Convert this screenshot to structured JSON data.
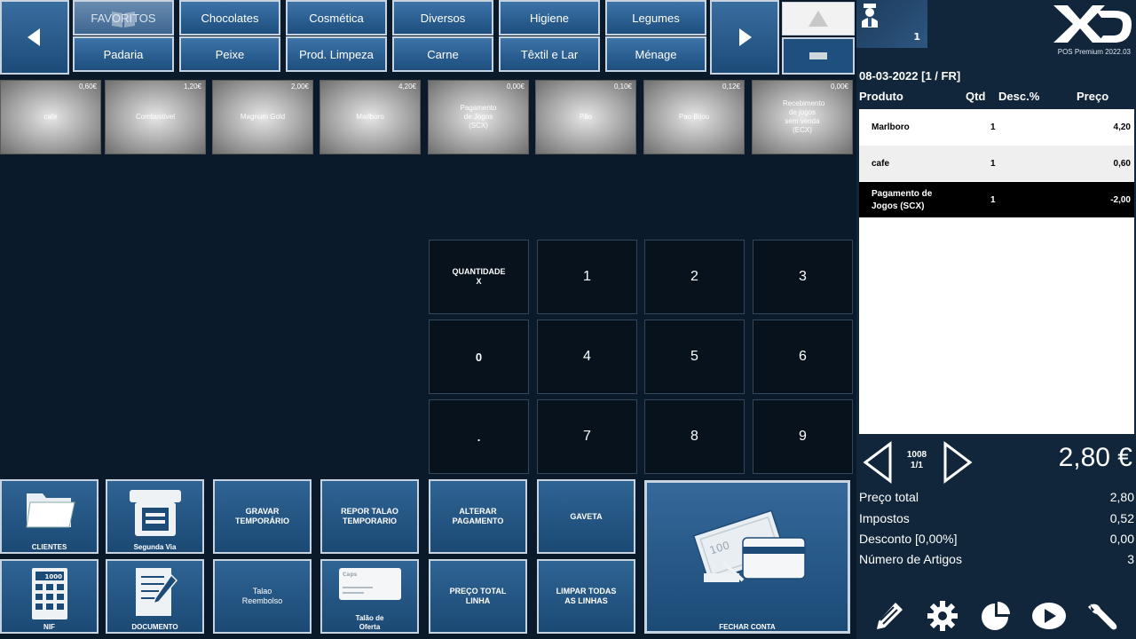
{
  "categories": {
    "row1": [
      "FAVORITOS",
      "Chocolates",
      "Cosmética",
      "Diversos",
      "Higiene",
      "Legumes"
    ],
    "row2": [
      "Padaria",
      "Peixe",
      "Prod. Limpeza",
      "Carne",
      "Têxtil e Lar",
      "Ménage"
    ]
  },
  "products": [
    {
      "name": "cafe",
      "price": "0,60€"
    },
    {
      "name": "Combustivel",
      "price": "1,20€"
    },
    {
      "name": "Magnum Gold",
      "price": "2,00€"
    },
    {
      "name": "Marlboro",
      "price": "4,20€"
    },
    {
      "name": "Pagamento de Jogos (SCX)",
      "price": "0,00€"
    },
    {
      "name": "Pão",
      "price": "0,10€"
    },
    {
      "name": "Pao Bijou",
      "price": "0,12€"
    },
    {
      "name": "Recebimento de jogos sem venda (ECX)",
      "price": "0,00€"
    }
  ],
  "keypad": {
    "qty_line1": "QUANTIDADE",
    "qty_line2": "X",
    "keys": [
      "1",
      "2",
      "3",
      "0",
      "4",
      "5",
      "6",
      ".",
      "7",
      "8",
      "9"
    ]
  },
  "actions": {
    "clientes": "CLIENTES",
    "segunda_via": "Segunda Via",
    "gravar_1": "GRAVAR",
    "gravar_2": "TEMPORÁRIO",
    "repor_1": "REPOR TALAO",
    "repor_2": "TEMPORARIO",
    "alterar_1": "ALTERAR",
    "alterar_2": "PAGAMENTO",
    "gaveta": "GAVETA",
    "nif": "NIF",
    "documento": "DOCUMENTO",
    "talao_reemb_1": "Talao",
    "talao_reemb_2": "Reembolso",
    "talao_oferta_1": "Talão de",
    "talao_oferta_2": "Oferta",
    "preco_total_1": "PREÇO TOTAL",
    "preco_total_2": "LINHA",
    "limpar_1": "LIMPAR TODAS",
    "limpar_2": "AS LINHAS",
    "fechar": "FECHAR CONTA",
    "calc_display": "1000",
    "card_label": "Caps",
    "note_value": "100"
  },
  "panel": {
    "user_count": "1",
    "version": "POS Premium 2022.03",
    "doc_date": "08-03-2022 [1 / FR]",
    "headers": {
      "produto": "Produto",
      "qtd": "Qtd",
      "desc": "Desc.%",
      "preco": "Preço"
    },
    "lines": [
      {
        "name1": "Marlboro",
        "name2": "",
        "qty": "1",
        "price": "4,20"
      },
      {
        "name1": "cafe",
        "name2": "",
        "qty": "1",
        "price": "0,60"
      },
      {
        "name1": "Pagamento de",
        "name2": "Jogos (SCX)",
        "qty": "1",
        "price": "-2,00"
      }
    ],
    "doc_num_1": "1008",
    "doc_num_2": "1/1",
    "total": "2,80 €",
    "summary": [
      {
        "label": "Preço total",
        "value": "2,80"
      },
      {
        "label": "Impostos",
        "value": "0,52"
      },
      {
        "label": "Desconto [0,00%]",
        "value": "0,00"
      },
      {
        "label": "Número de Artigos",
        "value": "3"
      }
    ]
  },
  "colors": {
    "button_blue": "#2f6494",
    "background": "#0a1a2a",
    "selected_row": "#000000"
  }
}
